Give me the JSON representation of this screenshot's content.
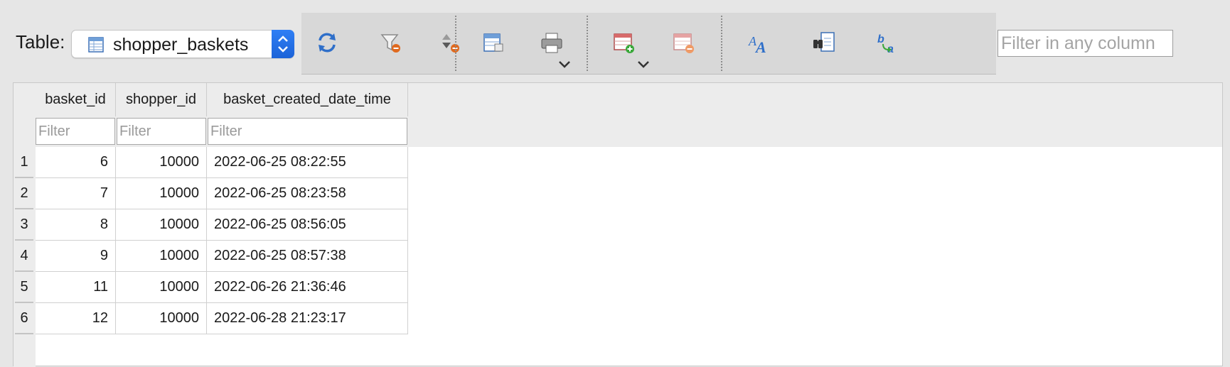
{
  "header": {
    "table_label": "Table:",
    "selected_table": "shopper_baskets"
  },
  "toolbar": {
    "buttons": [
      {
        "icon": "refresh-icon"
      },
      {
        "icon": "clear-filter-icon"
      },
      {
        "icon": "clear-sort-icon"
      },
      {
        "icon": "export-icon",
        "dropdown": true
      },
      {
        "icon": "print-icon"
      },
      {
        "icon": "add-record-icon",
        "dropdown": true
      },
      {
        "icon": "delete-record-icon"
      },
      {
        "icon": "font-size-icon"
      },
      {
        "icon": "find-icon"
      },
      {
        "icon": "find-replace-icon"
      }
    ],
    "search_placeholder": "Filter in any column"
  },
  "grid": {
    "columns": [
      "basket_id",
      "shopper_id",
      "basket_created_date_time"
    ],
    "filter_placeholder": "Filter",
    "rows": [
      {
        "num": "1",
        "basket_id": "6",
        "shopper_id": "10000",
        "created": "2022-06-25 08:22:55"
      },
      {
        "num": "2",
        "basket_id": "7",
        "shopper_id": "10000",
        "created": "2022-06-25 08:23:58"
      },
      {
        "num": "3",
        "basket_id": "8",
        "shopper_id": "10000",
        "created": "2022-06-25 08:56:05"
      },
      {
        "num": "4",
        "basket_id": "9",
        "shopper_id": "10000",
        "created": "2022-06-25 08:57:38"
      },
      {
        "num": "5",
        "basket_id": "11",
        "shopper_id": "10000",
        "created": "2022-06-26 21:36:46"
      },
      {
        "num": "6",
        "basket_id": "12",
        "shopper_id": "10000",
        "created": "2022-06-28 21:23:17"
      }
    ]
  },
  "colors": {
    "accent": "#1c63d8",
    "header_band": "#ececec",
    "toolbar_bg": "#d8d8d8"
  }
}
